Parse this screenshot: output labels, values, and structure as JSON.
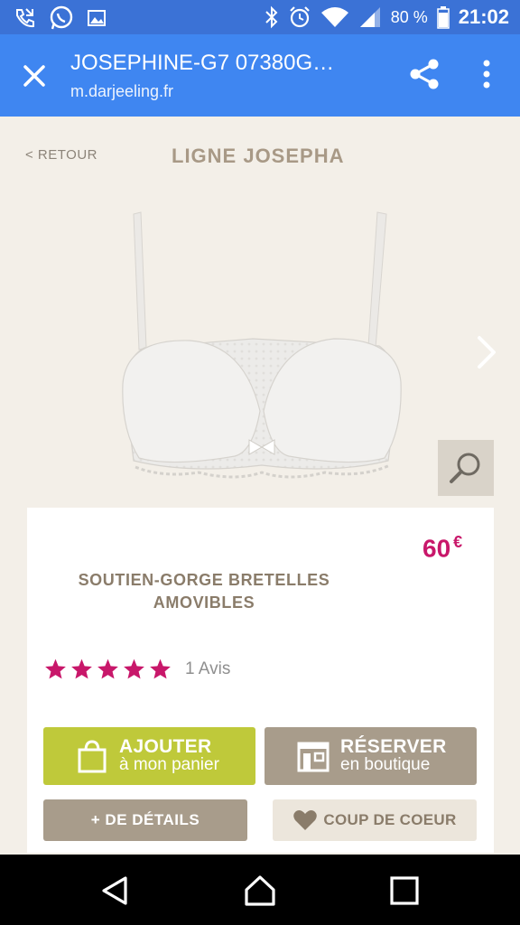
{
  "status_bar": {
    "battery": "80 %",
    "time": "21:02",
    "icons": [
      "missed-call-icon",
      "whatsapp-icon",
      "image-icon",
      "bluetooth-icon",
      "alarm-icon",
      "wifi-icon",
      "signal-icon",
      "battery-icon"
    ]
  },
  "toolbar": {
    "title": "JOSEPHINE-G7 07380G…",
    "url": "m.darjeeling.fr",
    "icons": [
      "close-icon",
      "share-icon",
      "more-vert-icon"
    ]
  },
  "page": {
    "back_label": "< RETOUR",
    "title": "LIGNE JOSEPHA"
  },
  "product": {
    "price": "60",
    "currency": "€",
    "name_line1": "SOUTIEN-GORGE BRETELLES",
    "name_line2": "AMOVIBLES",
    "rating": 5,
    "rating_max": 5,
    "reviews": "1 Avis",
    "star_color": "#c8176a",
    "price_color": "#c8176a"
  },
  "buttons": {
    "add_main": "AJOUTER",
    "add_sub": "à mon panier",
    "reserve_main": "RÉSERVER",
    "reserve_sub": "en boutique",
    "details": "+ DE DÉTAILS",
    "favorite": "COUP DE COEUR"
  },
  "colors": {
    "toolbar": "#3f86f1",
    "status_bar": "#3b72d6",
    "add_button": "#bfc93a",
    "taupe_button": "#a89c8b",
    "background": "#f3efe8"
  }
}
